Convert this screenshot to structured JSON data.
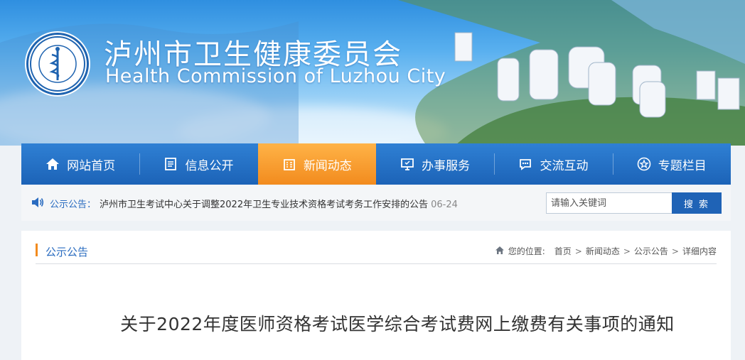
{
  "site": {
    "title_cn": "泸州市卫生健康委员会",
    "title_en": "Health Commission of Luzhou City",
    "logo_icon": "health-commission-emblem-icon",
    "brand_color": "#1f63b6",
    "accent_color": "#f28b1e"
  },
  "nav": {
    "items": [
      {
        "label": "网站首页",
        "icon": "home-icon"
      },
      {
        "label": "信息公开",
        "icon": "document-icon"
      },
      {
        "label": "新闻动态",
        "icon": "building-icon",
        "active": true
      },
      {
        "label": "办事服务",
        "icon": "monitor-icon"
      },
      {
        "label": "交流互动",
        "icon": "chat-icon"
      },
      {
        "label": "专题栏目",
        "icon": "star-icon"
      }
    ]
  },
  "notice": {
    "label": "公示公告：",
    "text": "泸州市卫生考试中心关于调整2022年卫生专业技术资格考试考务工作安排的公告",
    "date": "06-24",
    "icon": "speaker-icon"
  },
  "search": {
    "placeholder": "请输入关键词",
    "button_label": "搜 索"
  },
  "section": {
    "title": "公示公告"
  },
  "breadcrumb": {
    "prefix": "您的位置:",
    "items": [
      "首页",
      "新闻动态",
      "公示公告",
      "详细内容"
    ],
    "separator": ">"
  },
  "article": {
    "title": "关于2022年度医师资格考试医学综合考试费网上缴费有关事项的通知"
  }
}
